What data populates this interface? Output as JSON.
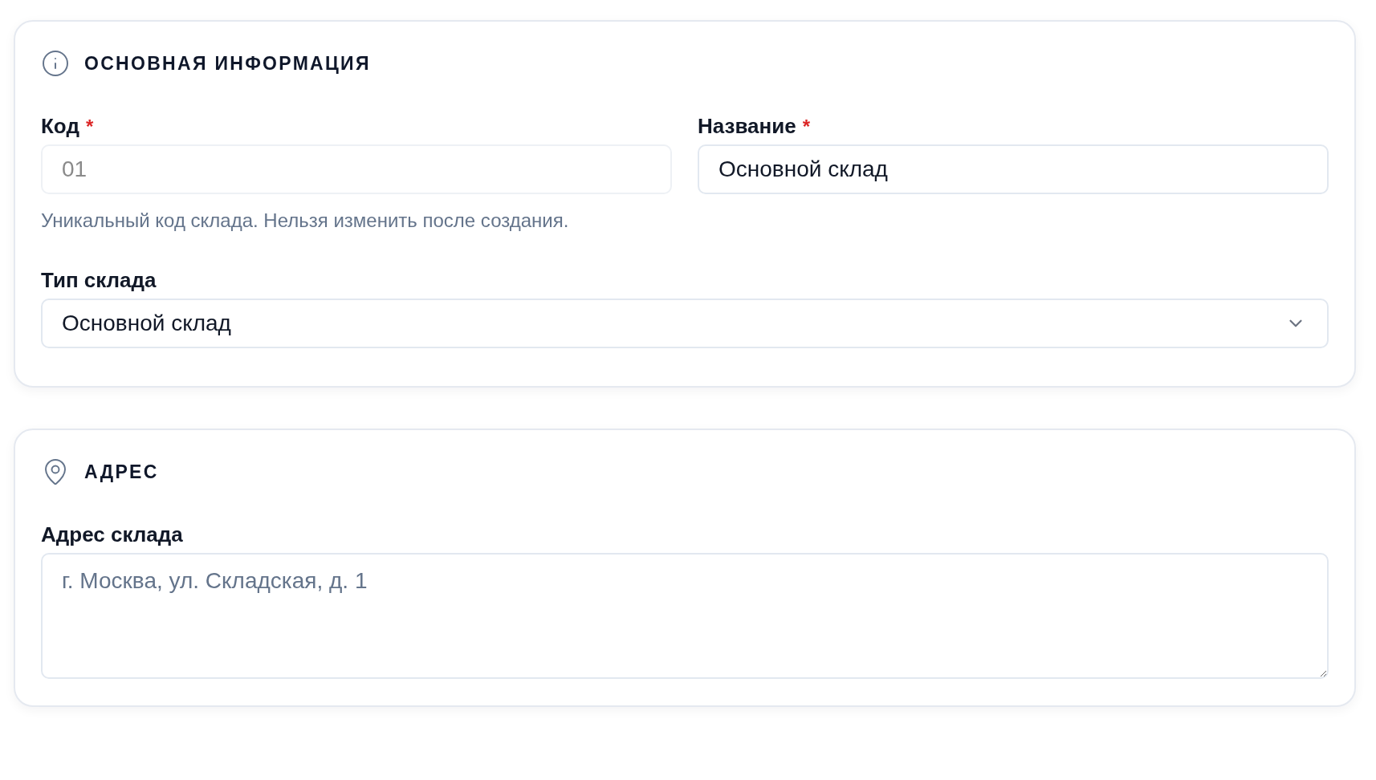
{
  "sections": [
    {
      "title": "ОСНОВНАЯ ИНФОРМАЦИЯ",
      "rows": [
        [
          {
            "kind": "text",
            "label": "Код",
            "required_mark": "*",
            "value": "01",
            "disabled": true,
            "hint": "Уникальный код склада. Нельзя изменить после создания."
          },
          {
            "kind": "text",
            "label": "Название",
            "required_mark": "*",
            "value": "Основной склад",
            "disabled": false
          }
        ],
        [
          {
            "kind": "select",
            "label": "Тип склада",
            "value": "Основной склад",
            "disabled": false
          }
        ]
      ]
    },
    {
      "title": "АДРЕС",
      "rows": [
        [
          {
            "kind": "textarea",
            "label": "Адрес склада",
            "placeholder": "г. Москва, ул. Складская, д. 1",
            "disabled": false
          }
        ]
      ]
    }
  ]
}
